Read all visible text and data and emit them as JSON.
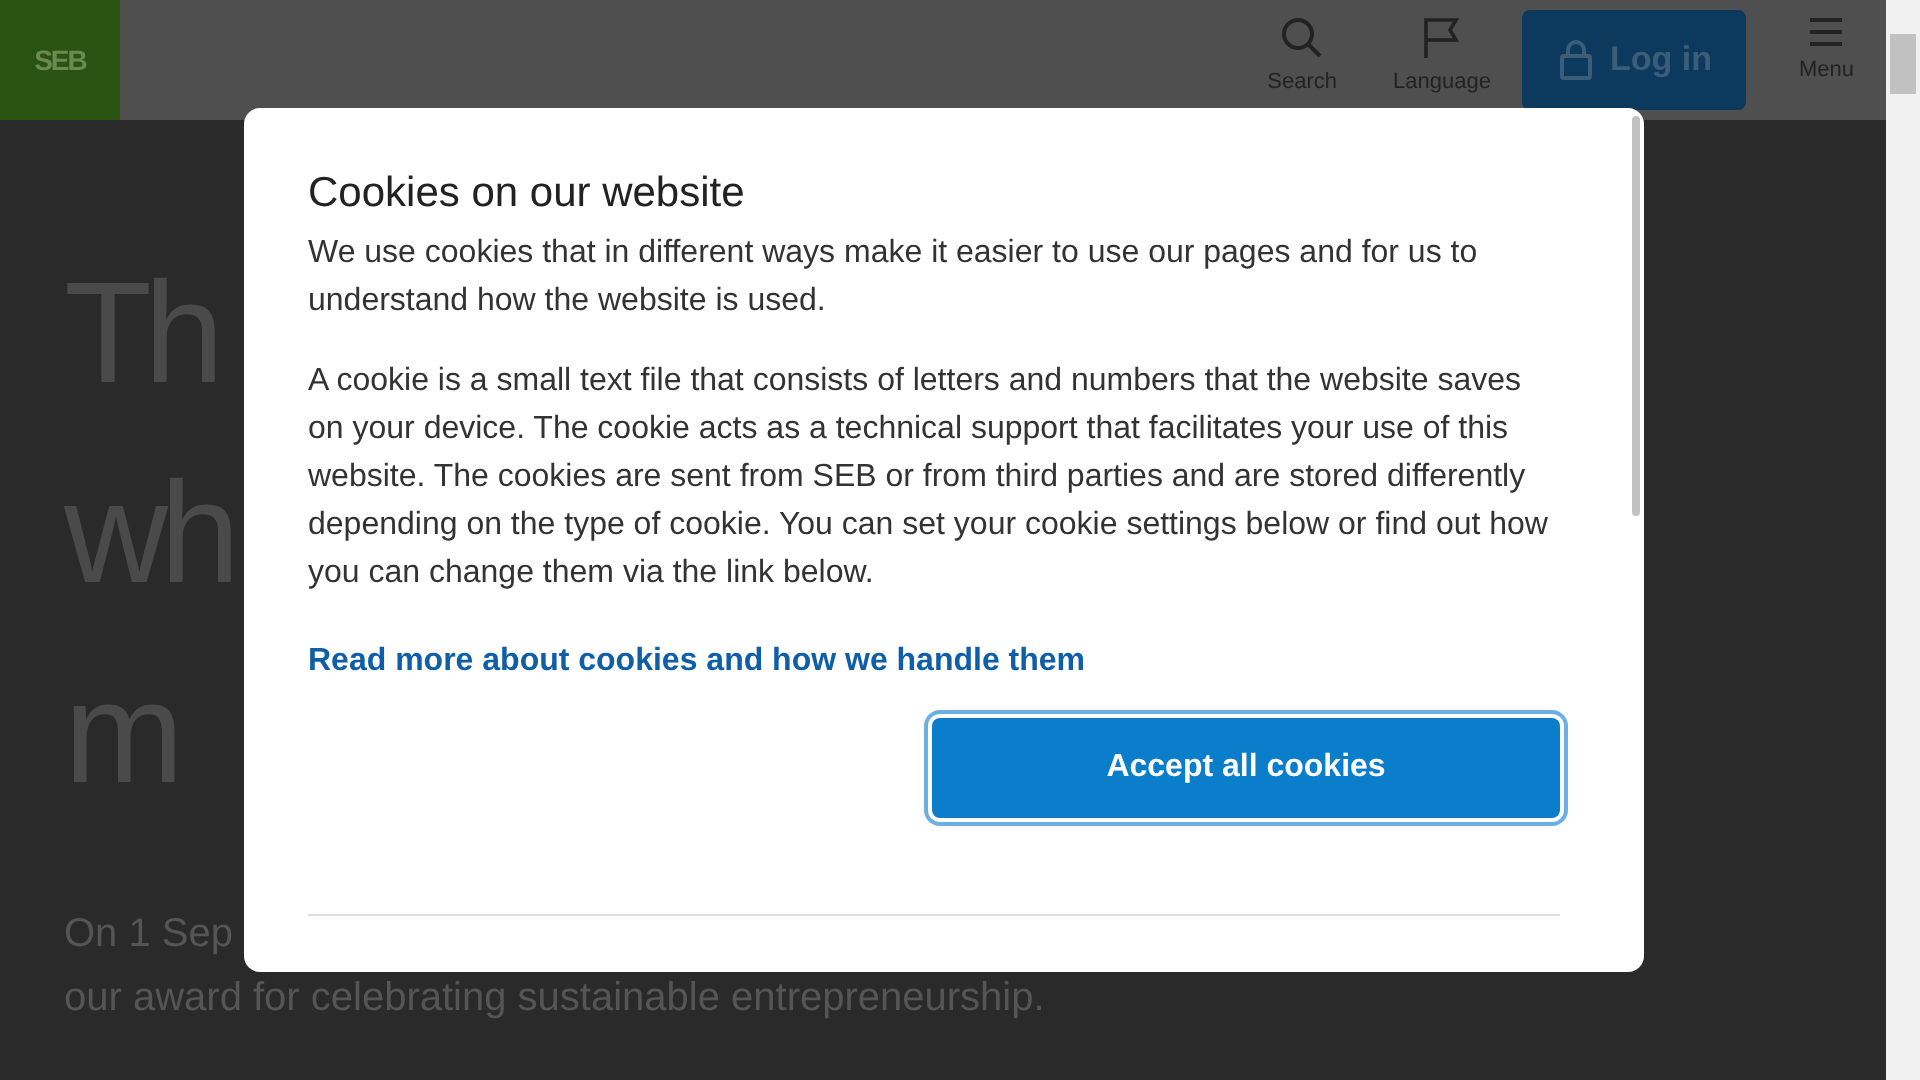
{
  "header": {
    "logo": "SEB",
    "actions": [
      {
        "kind": "search",
        "label": "Search"
      },
      {
        "kind": "language",
        "label": "Language"
      }
    ],
    "login": "Log in",
    "menu": "Menu"
  },
  "hero": {
    "title_lines": [
      "Th",
      "wh",
      "m"
    ],
    "intro_lines": [
      "On 1 Sep",
      "our award for celebrating sustainable entrepreneurship."
    ]
  },
  "dialog": {
    "title": "Cookies on our website",
    "paragraphs": [
      "We use cookies that in different ways make it easier to use our pages and for us to understand how the website is used.",
      "A cookie is a small text file that consists of letters and numbers that the website saves on your device. The cookie acts as a technical support that facilitates your use of this website. The cookies are sent from SEB or from third parties and are stored differently depending on the type of cookie. You can set your cookie settings below or find out how you can change them via the link below."
    ],
    "link": "Read more about cookies and how we handle them",
    "accept": "Accept all cookies"
  }
}
